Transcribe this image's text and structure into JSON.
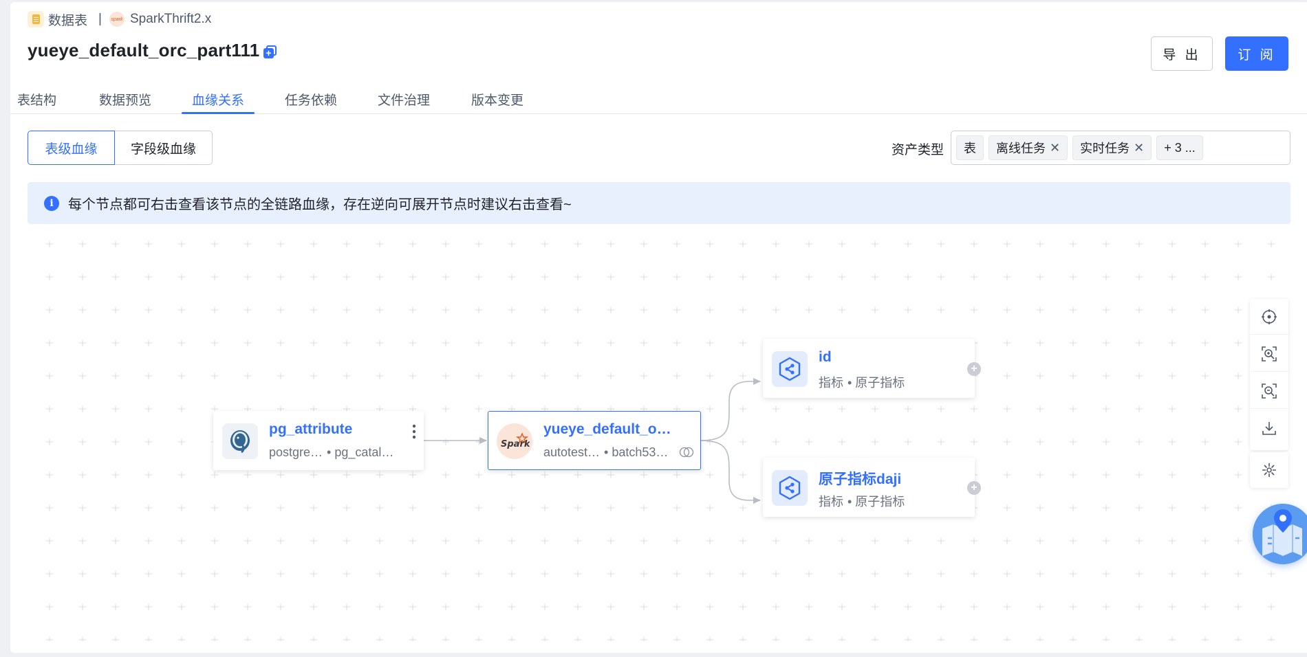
{
  "breadcrumb": {
    "type_label": "数据表",
    "separator": "|",
    "source_label": "SparkThrift2.x"
  },
  "title": "yueye_default_orc_part111",
  "header_buttons": {
    "export": "导 出",
    "subscribe": "订 阅"
  },
  "tabs": [
    {
      "label": "表结构",
      "active": false
    },
    {
      "label": "数据预览",
      "active": false
    },
    {
      "label": "血缘关系",
      "active": true
    },
    {
      "label": "任务依赖",
      "active": false
    },
    {
      "label": "文件治理",
      "active": false
    },
    {
      "label": "版本变更",
      "active": false
    }
  ],
  "lineage_mode": {
    "table": "表级血缘",
    "field": "字段级血缘",
    "selected": "表级血缘"
  },
  "asset_filter": {
    "label": "资产类型",
    "tags": [
      "表",
      "离线任务",
      "实时任务"
    ],
    "more": "+ 3 ..."
  },
  "info_banner": "每个节点都可右击查看该节点的全链路血缘，存在逆向可展开节点时建议右击查看~",
  "nodes": {
    "source": {
      "name": "pg_attribute",
      "meta1": "postgre…",
      "meta2": "• pg_catal…"
    },
    "current": {
      "name": "yueye_default_o…",
      "meta1": "autotest…",
      "meta2": "• batch53…"
    },
    "target1": {
      "name": "id",
      "meta1": "指标",
      "meta2": "• 原子指标"
    },
    "target2": {
      "name": "原子指标daji",
      "meta1": "指标",
      "meta2": "• 原子指标"
    }
  },
  "colors": {
    "accent": "#3370ff",
    "info_bg": "#e8f0fe",
    "edge": "#b8bcc4"
  }
}
